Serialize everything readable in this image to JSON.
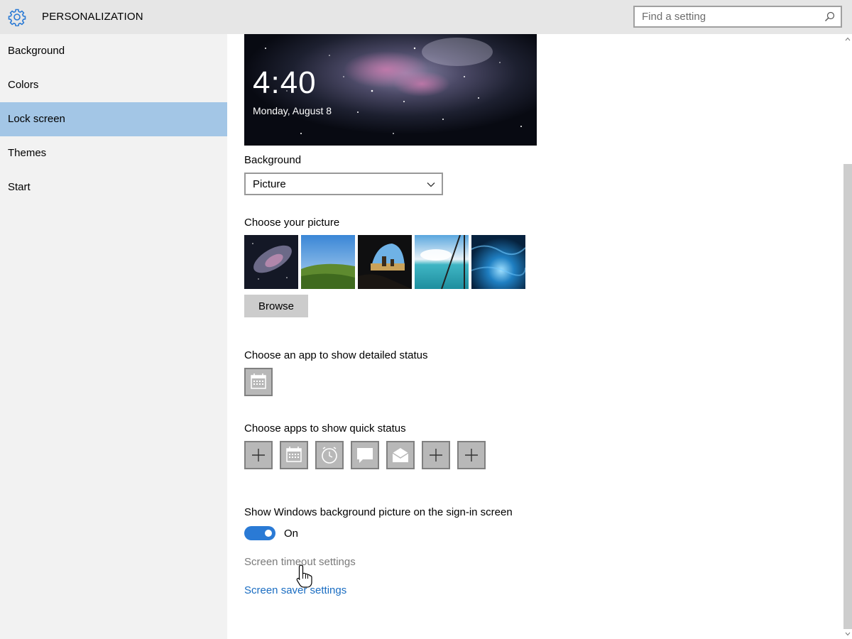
{
  "header": {
    "title": "PERSONALIZATION",
    "search_placeholder": "Find a setting",
    "icon": "gear-icon"
  },
  "sidebar": {
    "items": [
      {
        "label": "Background",
        "selected": false
      },
      {
        "label": "Colors",
        "selected": false
      },
      {
        "label": "Lock screen",
        "selected": true
      },
      {
        "label": "Themes",
        "selected": false
      },
      {
        "label": "Start",
        "selected": false
      }
    ]
  },
  "preview": {
    "time": "4:40",
    "date": "Monday, August 8"
  },
  "background_section": {
    "label": "Background",
    "selected": "Picture"
  },
  "picture_section": {
    "label": "Choose your picture",
    "thumbnails": [
      "galaxy",
      "green-hill",
      "cave-beach",
      "ocean-window",
      "underwater-ice"
    ],
    "browse_label": "Browse"
  },
  "detailed_status": {
    "label": "Choose an app to show detailed status",
    "app_icon": "calendar-icon"
  },
  "quick_status": {
    "label": "Choose apps to show quick status",
    "apps": [
      "plus-icon",
      "calendar-icon",
      "alarm-clock-icon",
      "message-icon",
      "mail-icon",
      "plus-icon",
      "plus-icon"
    ]
  },
  "signin": {
    "label": "Show Windows background picture on the sign-in screen",
    "toggle_state": "On",
    "toggle_on": true
  },
  "links": {
    "screen_timeout": "Screen timeout settings",
    "screen_saver": "Screen saver settings"
  },
  "colors": {
    "accent": "#2a7ad5",
    "selected_nav": "#a3c6e6",
    "link": "#1a6dc2",
    "sidebar_bg": "#f2f2f2",
    "header_bg": "#e6e6e6"
  }
}
